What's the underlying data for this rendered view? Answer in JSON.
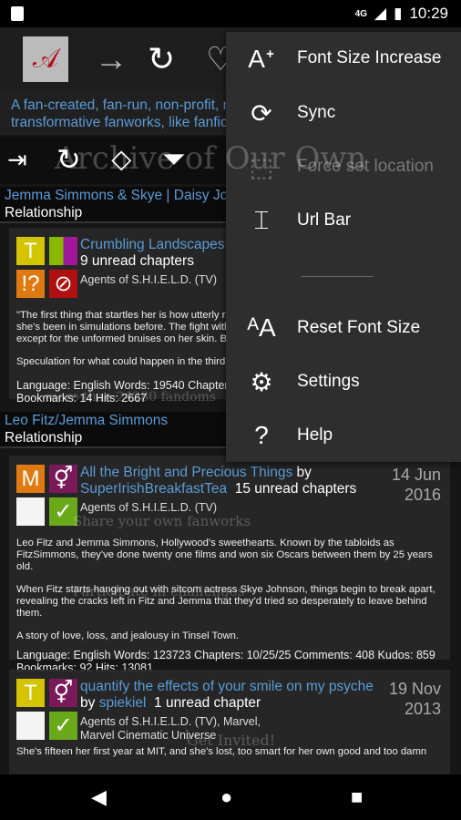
{
  "status": {
    "network": "4G",
    "time": "10:29"
  },
  "toolbar": {
    "logo": "A3",
    "icons": [
      "forward-arrow-icon",
      "refresh-icon",
      "bookmark-icon"
    ]
  },
  "intro": {
    "line1": "A fan-created, fan-run, non-profit, no",
    "line2": "transformative fanworks, like fanfic"
  },
  "background": {
    "title": "Archive of Our Own",
    "lines": [
      "more than 24280 fandoms",
      "Share your own fanworks",
      "Participate in challenges",
      "Get Invited!"
    ]
  },
  "iconbar": [
    "indent-icon",
    "refresh-icon",
    "tag-icon",
    "filter-icon"
  ],
  "groups": [
    {
      "relationship": "Jemma Simmons & Skye | Daisy Joh",
      "type": "Relationship"
    },
    {
      "relationship": "Leo Fitz/Jemma Simmons",
      "type": "Relationship"
    }
  ],
  "works": [
    {
      "title": "Crumbling Landscapes",
      "by": "",
      "author": "",
      "unread": "9 unread chapters",
      "fandom": "Agents of S.H.I.E.L.D. (TV)",
      "date": "",
      "summary": [
        "\"The first thing that startles her is how utterly r",
        "she's been in simulations before. The fight with",
        "except for the unformed bruises on her skin. Bu",
        "Speculation for what could happen in the third"
      ],
      "stats1": "Language: English   Words: 19540   Chapters",
      "stats2": "Bookmarks: 14   Hits: 2667",
      "badges": [
        "T",
        "multi",
        "!?",
        "no"
      ]
    },
    {
      "title": "All the Bright and Precious Things",
      "by": "by",
      "author": "SuperIrishBreakfastTea",
      "unread": "15 unread chapters",
      "fandom": "Agents of S.H.I.E.L.D. (TV)",
      "date1": "14 Jun",
      "date2": "2016",
      "summary": [
        "Leo Fitz and Jemma Simmons, Hollywood's sweethearts. Known by the tabloids as FitzSimmons, they've done twenty one films and won six Oscars between them by 25 years old.",
        "When Fitz starts hanging out with sitcom actress Skye Johnson, things begin to break apart, revealing the cracks left in Fitz and Jemma that they'd tried so desperately to leave behind them.",
        "A story of love, loss, and jealousy in Tinsel Town."
      ],
      "stats1": "Language: English   Words: 123723   Chapters: 10/25/25   Comments: 408   Kudos: 859",
      "stats2": "Bookmarks: 92   Hits: 13081",
      "badges": [
        "M",
        "⚥",
        "",
        "✓"
      ]
    },
    {
      "title": "quantify the effects of your smile on my psyche",
      "by": "by",
      "author": "spiekiel",
      "unread": "1 unread chapter",
      "fandom": "Agents of S.H.I.E.L.D. (TV),  Marvel,",
      "fandom2": "Marvel Cinematic Universe",
      "date1": "19 Nov",
      "date2": "2013",
      "summary": [
        "She's fifteen her first year at MIT, and she's lost, too smart for her own good and too damn"
      ],
      "badges": [
        "T",
        "⚥",
        "",
        "✓"
      ]
    }
  ],
  "menu": [
    {
      "label": "Font Size Increase",
      "icon": "font-size-increase-icon",
      "enabled": true
    },
    {
      "label": "Sync",
      "icon": "sync-icon",
      "enabled": true
    },
    {
      "label": "Force set location",
      "icon": "location-icon",
      "enabled": false
    },
    {
      "label": "Url Bar",
      "icon": "url-bar-icon",
      "enabled": true
    },
    {
      "label": "Reset Font Size",
      "icon": "reset-font-icon",
      "enabled": true
    },
    {
      "label": "Settings",
      "icon": "gear-icon",
      "enabled": true
    },
    {
      "label": "Help",
      "icon": "help-icon",
      "enabled": true
    }
  ],
  "colors": {
    "link": "#5b9bd5",
    "menu_bg": "#2e2e2e",
    "badge_yellow": "#d4c400",
    "badge_orange": "#e07a10",
    "badge_red": "#b01010",
    "badge_purple": "#7a1a5a",
    "badge_green": "#6aaa1a"
  }
}
